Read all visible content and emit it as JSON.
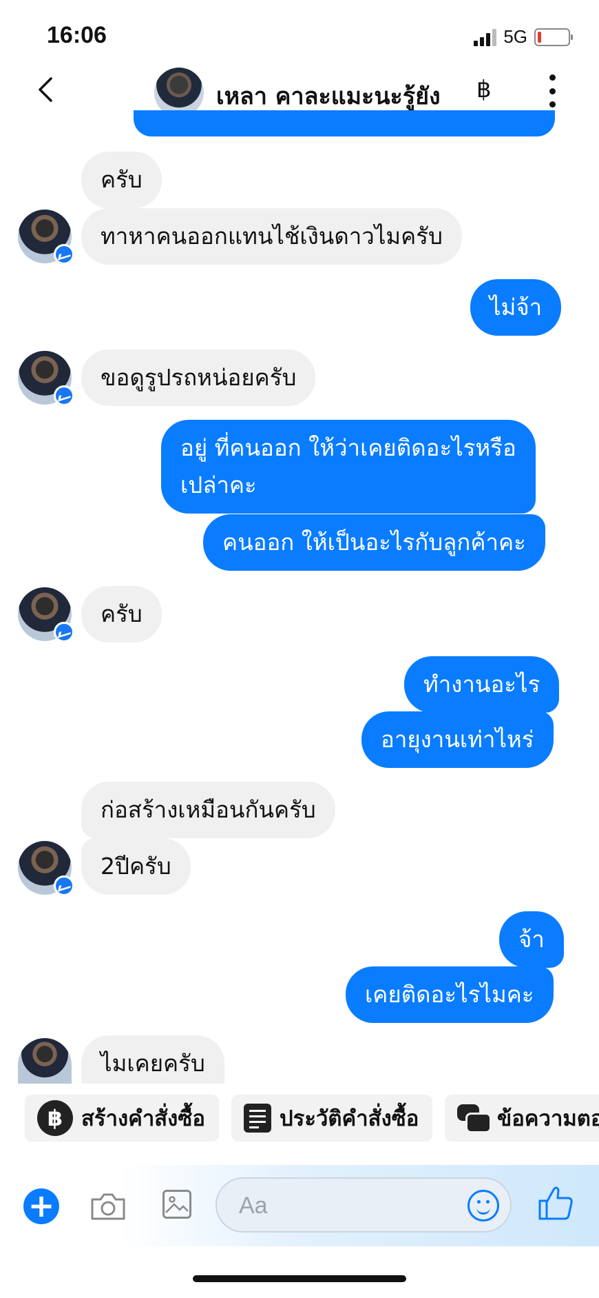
{
  "status_bar": {
    "time": "16:06",
    "network": "5G"
  },
  "header": {
    "contact_name": "เหลา คาละแมะนะรู้ยัง",
    "currency_icon_glyph": "฿"
  },
  "messages": [
    {
      "side": "in",
      "text": "ครับ"
    },
    {
      "side": "in",
      "text": "ทาหาคนออกแทนไช้เงินดาวไมครับ"
    },
    {
      "side": "out",
      "text": "ไม่จ้า"
    },
    {
      "side": "in",
      "text": "ขอดูรูปรถหน่อยครับ"
    },
    {
      "side": "out",
      "text_line1": "อยู่ ที่คนออก ให้ว่าเคยติดอะไรหรือ",
      "text_line2": "เปล่าคะ"
    },
    {
      "side": "out",
      "text": "คนออก ให้เป็นอะไรกับลูกค้าคะ"
    },
    {
      "side": "in",
      "text": "ครับ"
    },
    {
      "side": "out",
      "text": "ทำงานอะไร"
    },
    {
      "side": "out",
      "text": "อายุงานเท่าไหร่"
    },
    {
      "side": "in",
      "text": "ก่อสร้างเหมือนกันครับ"
    },
    {
      "side": "in",
      "text": "2ปีครับ"
    },
    {
      "side": "out",
      "text": "จ้า"
    },
    {
      "side": "out",
      "text": "เคยติดอะไรไมคะ"
    },
    {
      "side": "in",
      "text": "ไมเคยครับ"
    }
  ],
  "quick_actions": [
    {
      "label": "สร้างคำสั่งซื้อ",
      "icon": "baht-icon",
      "glyph": "฿"
    },
    {
      "label": "ประวัติคำสั่งซื้อ",
      "icon": "order-history-icon"
    },
    {
      "label": "ข้อความตอ",
      "icon": "saved-replies-icon"
    }
  ],
  "composer": {
    "placeholder": "Aa"
  },
  "colors": {
    "accent": "#0a7cff",
    "incoming_bubble": "#f0f0f0"
  }
}
